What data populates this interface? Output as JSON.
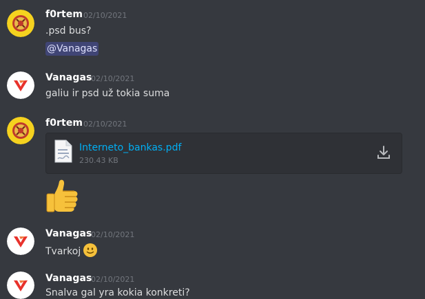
{
  "messages": [
    {
      "user": "f0rtem",
      "timestamp": "02/10/2021",
      "text": ".psd bus?",
      "mention": "@Vanagas"
    },
    {
      "user": "Vanagas",
      "timestamp": "02/10/2021",
      "text": "galiu ir psd už tokia suma"
    },
    {
      "user": "f0rtem",
      "timestamp": "02/10/2021",
      "attachment": {
        "name": "Interneto_bankas.pdf",
        "size": "230.43 KB"
      },
      "reaction_emoji": "thumbs-up"
    },
    {
      "user": "Vanagas",
      "timestamp": "02/10/2021",
      "text": "Tvarkoj",
      "emoji": "slightly-smiling-face"
    },
    {
      "user": "Vanagas",
      "timestamp": "02/10/2021",
      "text": "Snalva gal yra kokia konkreti?"
    }
  ],
  "colors": {
    "background": "#36393f",
    "link": "#00aff4",
    "mention_bg": "#4e5592"
  }
}
